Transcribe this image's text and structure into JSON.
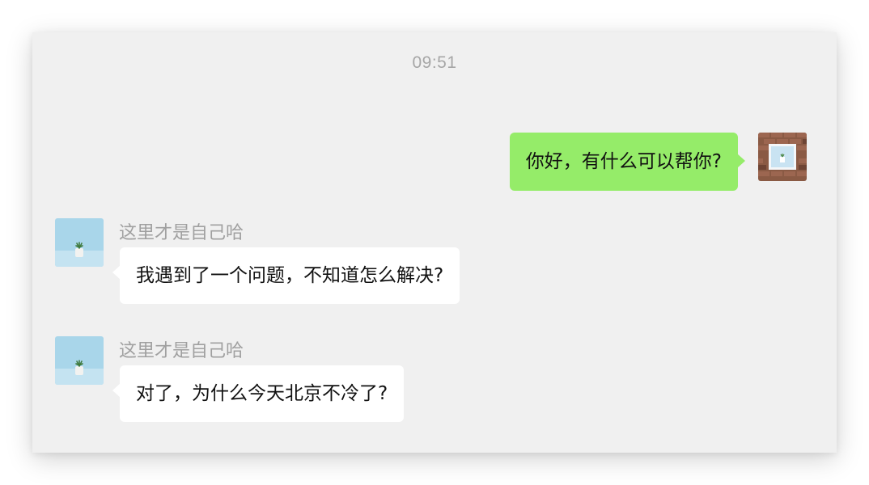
{
  "chat": {
    "timestamp": "09:51",
    "messages": [
      {
        "direction": "out",
        "text": "你好，有什么可以帮你?"
      },
      {
        "direction": "in",
        "sender": "这里才是自己哈",
        "text": "我遇到了一个问题，不知道怎么解决?"
      },
      {
        "direction": "in",
        "sender": "这里才是自己哈",
        "text": "对了，为什么今天北京不冷了?"
      }
    ]
  },
  "icons": {
    "self_avatar": "brick-wall-frame-avatar",
    "contact_avatar": "potted-plant-avatar"
  },
  "colors": {
    "window_bg": "#f0f0f0",
    "outgoing_bubble": "#95ec69",
    "incoming_bubble": "#ffffff",
    "meta_text": "#a6a6a6"
  }
}
